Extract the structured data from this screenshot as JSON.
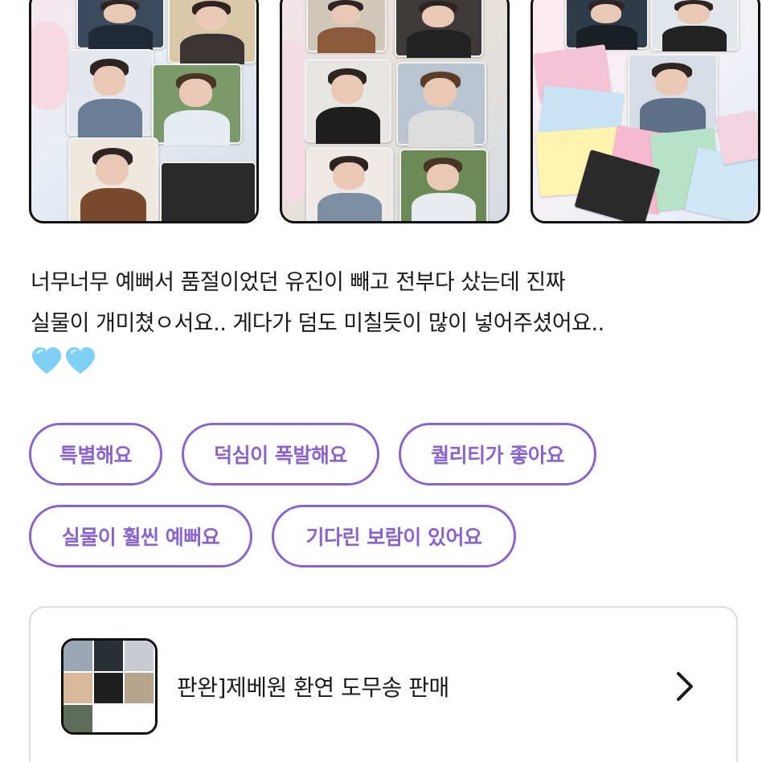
{
  "photos": [
    {
      "alt": "photocard binder 1"
    },
    {
      "alt": "photocard binder 2"
    },
    {
      "alt": "photocard pile"
    }
  ],
  "review": {
    "text": "너무너무 예뻐서 품절이었던 유진이 빼고 전부다 샀는데 진짜\n실물이 개미쳤ㅇ서요.. 게다가 덤도 미칠듯이 많이 넣어주셨어요..",
    "emoji": [
      "light-blue-heart",
      "light-blue-heart"
    ]
  },
  "tags": [
    {
      "label": "특별해요"
    },
    {
      "label": "덕심이 폭발해요"
    },
    {
      "label": "퀄리티가 좋아요"
    },
    {
      "label": "실물이 훨씬 예뻐요"
    },
    {
      "label": "기다린 보람이 있어요"
    }
  ],
  "product": {
    "title": "판완]제베원 환연 도무송 판매",
    "icon": "chevron-right-icon"
  },
  "colors": {
    "accent": "#8b63cf",
    "heart": "#7fd0f5",
    "card_border": "#dcdcdc"
  }
}
